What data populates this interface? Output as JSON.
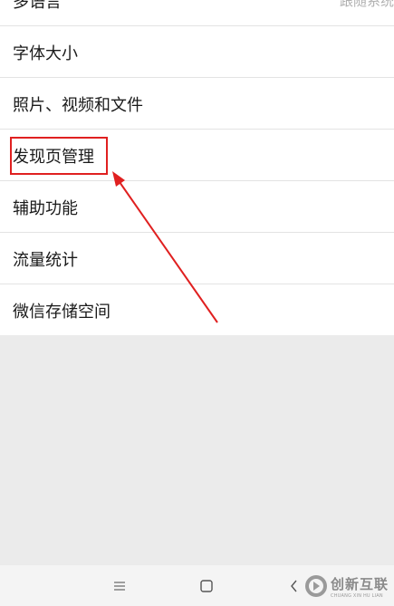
{
  "settings": {
    "items": [
      {
        "label": "多语言",
        "value": "跟随系统"
      },
      {
        "label": "字体大小",
        "value": ""
      },
      {
        "label": "照片、视频和文件",
        "value": ""
      },
      {
        "label": "发现页管理",
        "value": ""
      },
      {
        "label": "辅助功能",
        "value": ""
      },
      {
        "label": "流量统计",
        "value": ""
      },
      {
        "label": "微信存储空间",
        "value": ""
      }
    ]
  },
  "annotation": {
    "color": "#e02020",
    "highlighted_item": "发现页管理"
  },
  "nav_bar": {
    "menu_icon": "menu-lines-icon",
    "home_icon": "square-home-icon",
    "back_icon": "chevron-left-icon"
  },
  "watermark": {
    "name_cn": "创新互联",
    "name_en": "CHUANG XIN HU LIAN"
  }
}
